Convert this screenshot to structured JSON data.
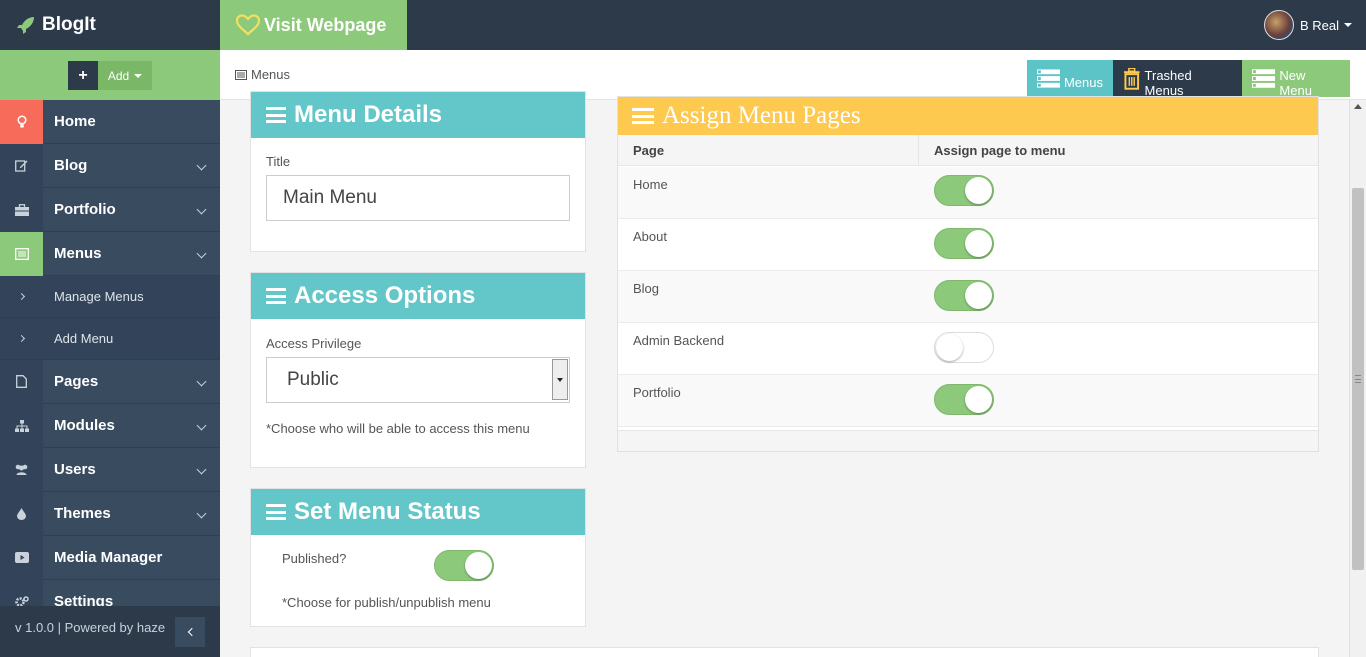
{
  "app": {
    "brand": "BlogIt",
    "visit_label": "Visit Webpage"
  },
  "user": {
    "name": "B Real"
  },
  "toolbar": {
    "add_label": "Add",
    "add_plus": "+"
  },
  "breadcrumb": {
    "current": "Menus"
  },
  "header_buttons": {
    "menus": "Menus",
    "trashed": "Trashed Menus",
    "new_menu": "New Menu"
  },
  "sidebar": {
    "items": [
      {
        "label": "Home"
      },
      {
        "label": "Blog"
      },
      {
        "label": "Portfolio"
      },
      {
        "label": "Menus"
      },
      {
        "label": "Pages"
      },
      {
        "label": "Modules"
      },
      {
        "label": "Users"
      },
      {
        "label": "Themes"
      },
      {
        "label": "Media Manager"
      },
      {
        "label": "Settings"
      }
    ],
    "subitems": [
      {
        "label": "Manage Menus"
      },
      {
        "label": "Add Menu"
      }
    ],
    "footer": "v 1.0.0 | Powered by haze"
  },
  "menu_details": {
    "title": "Menu Details",
    "title_label": "Title",
    "title_value": "Main Menu"
  },
  "access_options": {
    "title": "Access Options",
    "privilege_label": "Access Privilege",
    "privilege_value": "Public",
    "hint": "*Choose who will be able to access this menu"
  },
  "menu_status": {
    "title": "Set Menu Status",
    "published_label": "Published?",
    "published": true,
    "hint": "*Choose for publish/unpublish menu"
  },
  "assign_pages": {
    "title": "Assign Menu Pages",
    "col_page": "Page",
    "col_assign": "Assign page to menu",
    "rows": [
      {
        "page": "Home",
        "assigned": true
      },
      {
        "page": "About",
        "assigned": true
      },
      {
        "page": "Blog",
        "assigned": true
      },
      {
        "page": "Admin Backend",
        "assigned": false
      },
      {
        "page": "Portfolio",
        "assigned": true
      }
    ]
  },
  "colors": {
    "dark": "#2c3a4a",
    "green": "#8cc97a",
    "teal": "#63c6c8",
    "yellow": "#fdc94f",
    "coral": "#f76b5b"
  }
}
